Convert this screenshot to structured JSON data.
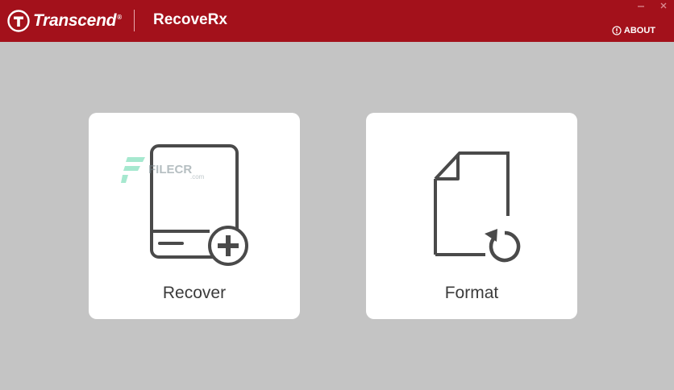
{
  "header": {
    "brand_name": "Transcend",
    "brand_reg": "®",
    "app_name": "RecoveRx",
    "about_label": "ABOUT"
  },
  "cards": {
    "recover": {
      "label": "Recover",
      "icon": "drive-plus-icon"
    },
    "format": {
      "label": "Format",
      "icon": "document-refresh-icon"
    }
  },
  "watermark": {
    "text": "FILECR",
    "sub": ".com"
  },
  "colors": {
    "header_bg": "#a3111b",
    "page_bg": "#c4c4c4",
    "card_bg": "#ffffff",
    "icon_stroke": "#4a4a4a",
    "label_text": "#3b3b3b",
    "watermark_green": "#5fd6a8"
  }
}
